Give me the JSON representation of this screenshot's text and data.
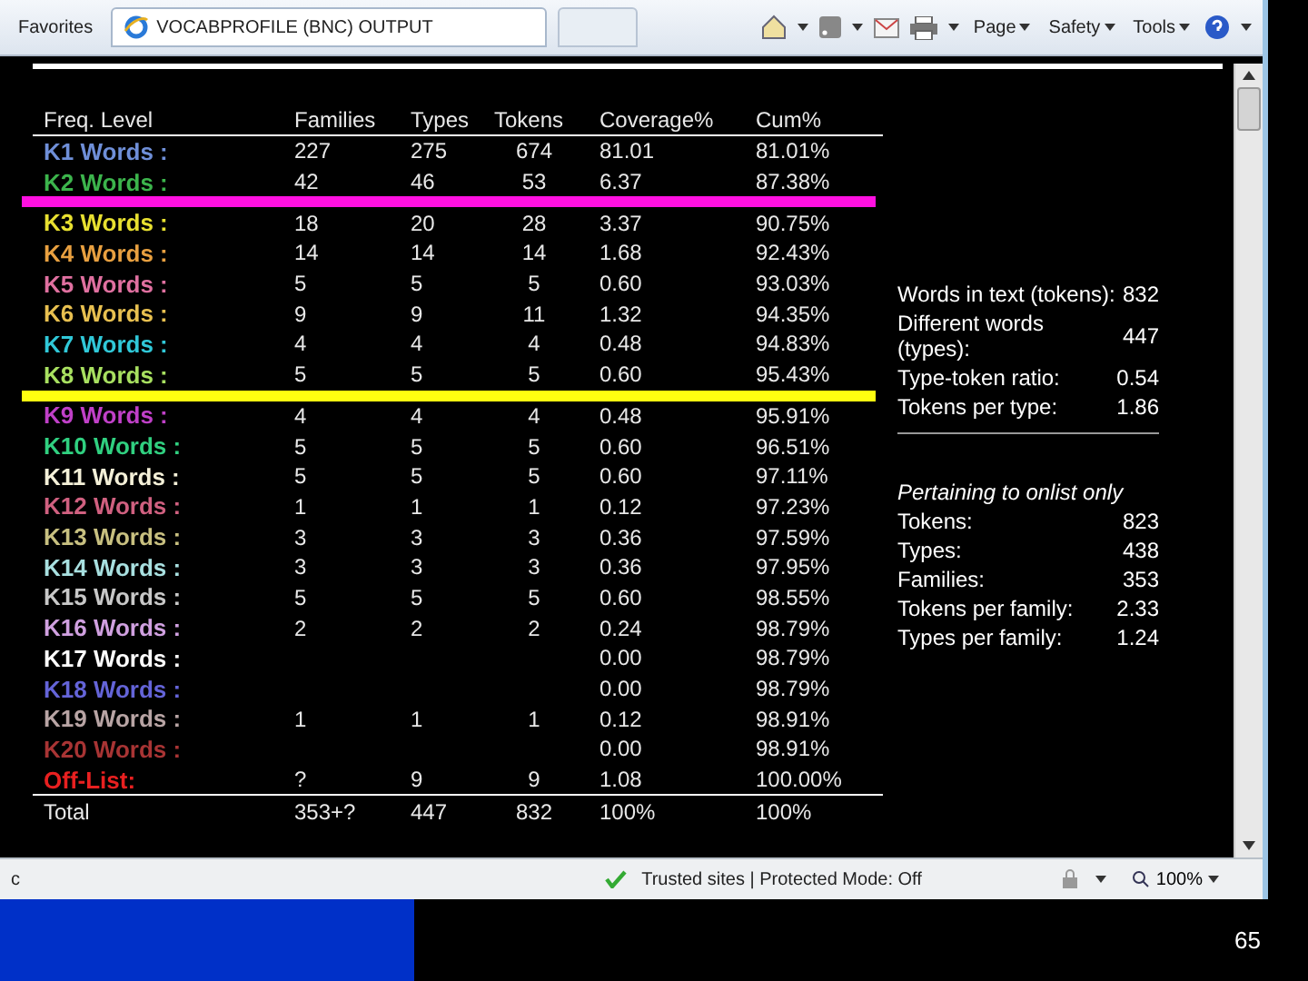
{
  "browser": {
    "favorites": "Favorites",
    "tab_title": "VOCABPROFILE (BNC) OUTPUT",
    "toolbar_menus": [
      "Page",
      "Safety",
      "Tools"
    ]
  },
  "table": {
    "columns": [
      "Freq. Level",
      "Families",
      "Types",
      "Tokens",
      "Coverage%",
      "Cum%"
    ],
    "rows": [
      {
        "label": "K1 Words :",
        "color": "#6f8fd8",
        "families": "227",
        "types": "275",
        "tokens": "674",
        "coverage": "81.01",
        "cum": "81.01%"
      },
      {
        "label": "K2 Words :",
        "color": "#3cb44c",
        "families": "42",
        "types": "46",
        "tokens": "53",
        "coverage": "6.37",
        "cum": "87.38%",
        "marker_below": {
          "color": "#ff10e0"
        }
      },
      {
        "label": "K3 Words :",
        "color": "#e8e030",
        "families": "18",
        "types": "20",
        "tokens": "28",
        "coverage": "3.37",
        "cum": "90.75%"
      },
      {
        "label": "K4 Words :",
        "color": "#e8a040",
        "families": "14",
        "types": "14",
        "tokens": "14",
        "coverage": "1.68",
        "cum": "92.43%"
      },
      {
        "label": "K5 Words :",
        "color": "#e070a0",
        "families": "5",
        "types": "5",
        "tokens": "5",
        "coverage": "0.60",
        "cum": "93.03%"
      },
      {
        "label": "K6 Words :",
        "color": "#e8c050",
        "families": "9",
        "types": "9",
        "tokens": "11",
        "coverage": "1.32",
        "cum": "94.35%"
      },
      {
        "label": "K7 Words :",
        "color": "#30c8d8",
        "families": "4",
        "types": "4",
        "tokens": "4",
        "coverage": "0.48",
        "cum": "94.83%"
      },
      {
        "label": "K8 Words :",
        "color": "#a8e060",
        "families": "5",
        "types": "5",
        "tokens": "5",
        "coverage": "0.60",
        "cum": "95.43%",
        "marker_below": {
          "color": "#ffff10"
        }
      },
      {
        "label": "K9 Words :",
        "color": "#c040c8",
        "families": "4",
        "types": "4",
        "tokens": "4",
        "coverage": "0.48",
        "cum": "95.91%"
      },
      {
        "label": "K10 Words :",
        "color": "#30d080",
        "families": "5",
        "types": "5",
        "tokens": "5",
        "coverage": "0.60",
        "cum": "96.51%"
      },
      {
        "label": "K11 Words :",
        "color": "#f4f0d8",
        "families": "5",
        "types": "5",
        "tokens": "5",
        "coverage": "0.60",
        "cum": "97.11%"
      },
      {
        "label": "K12 Words :",
        "color": "#d06080",
        "families": "1",
        "types": "1",
        "tokens": "1",
        "coverage": "0.12",
        "cum": "97.23%"
      },
      {
        "label": "K13 Words :",
        "color": "#c8c080",
        "families": "3",
        "types": "3",
        "tokens": "3",
        "coverage": "0.36",
        "cum": "97.59%"
      },
      {
        "label": "K14 Words :",
        "color": "#a8e0e0",
        "families": "3",
        "types": "3",
        "tokens": "3",
        "coverage": "0.36",
        "cum": "97.95%"
      },
      {
        "label": "K15 Words :",
        "color": "#c8c8c8",
        "families": "5",
        "types": "5",
        "tokens": "5",
        "coverage": "0.60",
        "cum": "98.55%"
      },
      {
        "label": "K16 Words :",
        "color": "#d0a0e0",
        "families": "2",
        "types": "2",
        "tokens": "2",
        "coverage": "0.24",
        "cum": "98.79%"
      },
      {
        "label": "K17 Words :",
        "color": "#ffffff",
        "coverage": "0.00",
        "cum": "98.79%"
      },
      {
        "label": "K18 Words :",
        "color": "#6464d8",
        "coverage": "0.00",
        "cum": "98.79%"
      },
      {
        "label": "K19 Words :",
        "color": "#b8a4a4",
        "families": "1",
        "types": "1",
        "tokens": "1",
        "coverage": "0.12",
        "cum": "98.91%"
      },
      {
        "label": "K20 Words :",
        "color": "#a83434",
        "coverage": "0.00",
        "cum": "98.91%"
      },
      {
        "label": "Off-List:",
        "color": "#e82020",
        "families": "?",
        "types": "9",
        "tokens": "9",
        "coverage": "1.08",
        "cum": "100.00%"
      }
    ],
    "total": {
      "label": "Total",
      "families": "353+?",
      "types": "447",
      "tokens": "832",
      "coverage": "100%",
      "cum": "100%"
    }
  },
  "stats": [
    {
      "label": "Words in text (tokens):",
      "value": "832"
    },
    {
      "label": "Different words (types):",
      "value": "447"
    },
    {
      "label": "Type-token ratio:",
      "value": "0.54"
    },
    {
      "label": "Tokens per type:",
      "value": "1.86"
    }
  ],
  "onlist": {
    "heading": "Pertaining to onlist only",
    "items": [
      {
        "label": "Tokens:",
        "value": "823"
      },
      {
        "label": "Types:",
        "value": "438"
      },
      {
        "label": "Families:",
        "value": "353"
      },
      {
        "label": "Tokens per family:",
        "value": "2.33"
      },
      {
        "label": "Types per family:",
        "value": "1.24"
      }
    ]
  },
  "status_bar": {
    "left": "c",
    "zone": "Trusted sites | Protected Mode: Off",
    "zoom": "100%"
  },
  "slide_number": "65"
}
